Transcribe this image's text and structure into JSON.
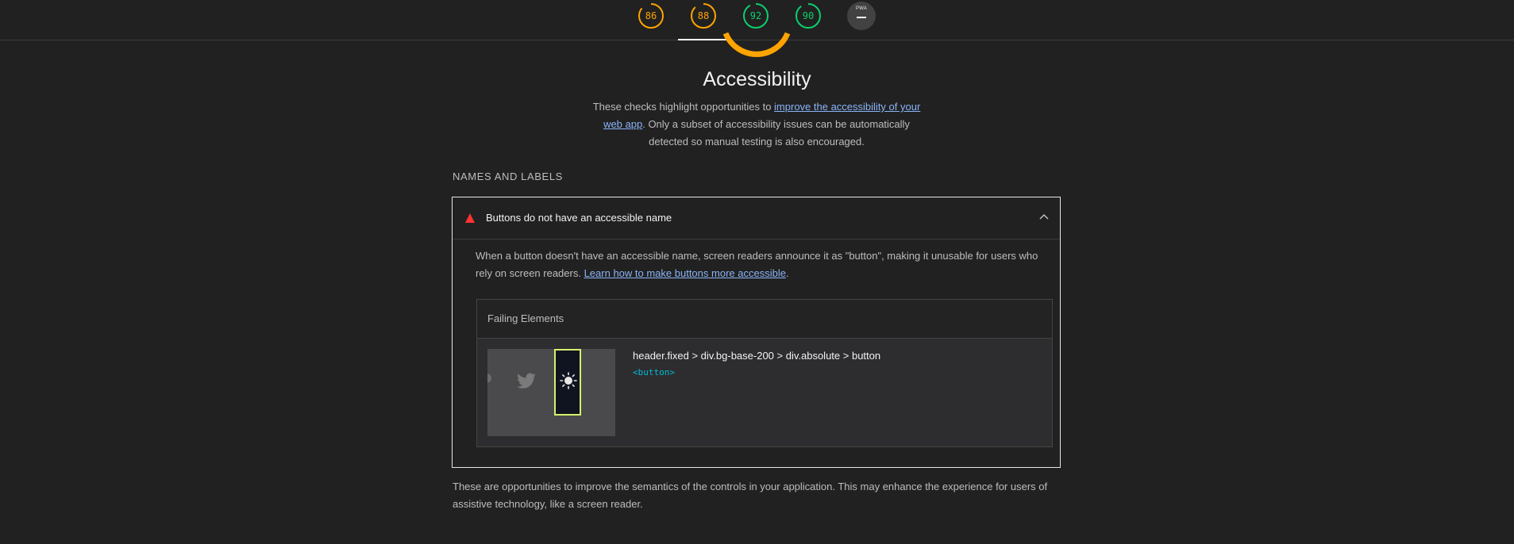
{
  "scores": [
    {
      "name": "performance",
      "value": "86",
      "color": "#ffa400"
    },
    {
      "name": "accessibility",
      "value": "88",
      "color": "#ffa400"
    },
    {
      "name": "best-practices",
      "value": "92",
      "color": "#0cce6b"
    },
    {
      "name": "seo",
      "value": "90",
      "color": "#0cce6b"
    }
  ],
  "pwa": {
    "label": "PWA"
  },
  "category": {
    "title": "Accessibility",
    "desc_before": "These checks highlight opportunities to ",
    "desc_link": "improve the accessibility of your web app",
    "desc_after": ". Only a subset of accessibility issues can be automatically detected so manual testing is also encouraged."
  },
  "group": {
    "title": "NAMES AND LABELS"
  },
  "audit": {
    "title": "Buttons do not have an accessible name",
    "desc_before": "When a button doesn't have an accessible name, screen readers announce it as \"button\", making it unusable for users who rely on screen readers. ",
    "desc_link": "Learn how to make buttons more accessible",
    "desc_after": ".",
    "table_header": "Failing Elements",
    "rows": [
      {
        "selector": "header.fixed > div.bg-base-200 > div.absolute > button",
        "snippet": "<button>"
      }
    ]
  },
  "footer": {
    "text": "These are opportunities to improve the semantics of the controls in your application. This may enhance the experience for users of assistive technology, like a screen reader."
  },
  "colors": {
    "fail": "#ff3333",
    "average": "#ffa400",
    "pass": "#0cce6b"
  }
}
